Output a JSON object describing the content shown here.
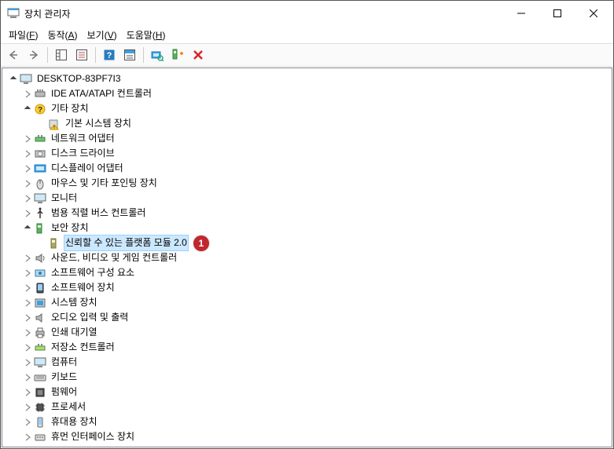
{
  "window": {
    "title": "장치 관리자"
  },
  "menu": {
    "file": {
      "label": "파일",
      "key": "F"
    },
    "action": {
      "label": "동작",
      "key": "A"
    },
    "view": {
      "label": "보기",
      "key": "V"
    },
    "help": {
      "label": "도움말",
      "key": "H"
    }
  },
  "tree": {
    "root": {
      "label": "DESKTOP-83PF7I3"
    },
    "items": [
      {
        "label": "IDE ATA/ATAPI 컨트롤러",
        "expanded": false,
        "icon": "ide",
        "indent": 1
      },
      {
        "label": "기타 장치",
        "expanded": true,
        "icon": "other",
        "indent": 1
      },
      {
        "label": "기본 시스템 장치",
        "expanded": null,
        "icon": "warn",
        "indent": 2
      },
      {
        "label": "네트워크 어댑터",
        "expanded": false,
        "icon": "net",
        "indent": 1
      },
      {
        "label": "디스크 드라이브",
        "expanded": false,
        "icon": "disk",
        "indent": 1
      },
      {
        "label": "디스플레이 어댑터",
        "expanded": false,
        "icon": "display",
        "indent": 1
      },
      {
        "label": "마우스 및 기타 포인팅 장치",
        "expanded": false,
        "icon": "mouse",
        "indent": 1
      },
      {
        "label": "모니터",
        "expanded": false,
        "icon": "monitor",
        "indent": 1
      },
      {
        "label": "범용 직렬 버스 컨트롤러",
        "expanded": false,
        "icon": "usb",
        "indent": 1
      },
      {
        "label": "보안 장치",
        "expanded": true,
        "icon": "sec",
        "indent": 1
      },
      {
        "label": "신뢰할 수 있는 플랫폼 모듈 2.0",
        "expanded": null,
        "icon": "tpm",
        "indent": 2,
        "selected": true
      },
      {
        "label": "사운드, 비디오 및 게임 컨트롤러",
        "expanded": false,
        "icon": "sound",
        "indent": 1
      },
      {
        "label": "소프트웨어 구성 요소",
        "expanded": false,
        "icon": "swcomp",
        "indent": 1
      },
      {
        "label": "소프트웨어 장치",
        "expanded": false,
        "icon": "swdev",
        "indent": 1
      },
      {
        "label": "시스템 장치",
        "expanded": false,
        "icon": "sys",
        "indent": 1
      },
      {
        "label": "오디오 입력 및 출력",
        "expanded": false,
        "icon": "audio",
        "indent": 1
      },
      {
        "label": "인쇄 대기열",
        "expanded": false,
        "icon": "print",
        "indent": 1
      },
      {
        "label": "저장소 컨트롤러",
        "expanded": false,
        "icon": "storage",
        "indent": 1
      },
      {
        "label": "컴퓨터",
        "expanded": false,
        "icon": "computer",
        "indent": 1
      },
      {
        "label": "키보드",
        "expanded": false,
        "icon": "kbd",
        "indent": 1
      },
      {
        "label": "펌웨어",
        "expanded": false,
        "icon": "fw",
        "indent": 1
      },
      {
        "label": "프로세서",
        "expanded": false,
        "icon": "cpu",
        "indent": 1
      },
      {
        "label": "휴대용 장치",
        "expanded": false,
        "icon": "portable",
        "indent": 1
      },
      {
        "label": "휴먼 인터페이스 장치",
        "expanded": false,
        "icon": "hid",
        "indent": 1
      }
    ]
  },
  "callout": {
    "number": "1"
  }
}
